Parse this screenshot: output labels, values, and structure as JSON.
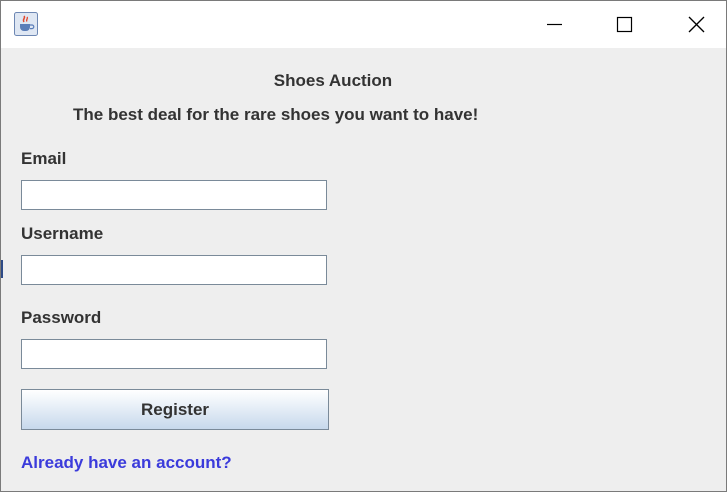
{
  "window": {
    "icon": "java-cup-icon",
    "controls": [
      "minimize-icon",
      "maximize-icon",
      "close-icon"
    ]
  },
  "header": {
    "title": "Shoes Auction",
    "tagline": "The best deal for the rare shoes you want to have!"
  },
  "form": {
    "email_label": "Email",
    "email_value": "",
    "username_label": "Username",
    "username_value": "",
    "password_label": "Password",
    "password_value": "",
    "register_label": "Register",
    "login_link": "Already have an account?"
  },
  "colors": {
    "background": "#eeeeee",
    "text": "#333333",
    "link": "#3b3bdb",
    "field_border": "#7a8a99"
  }
}
